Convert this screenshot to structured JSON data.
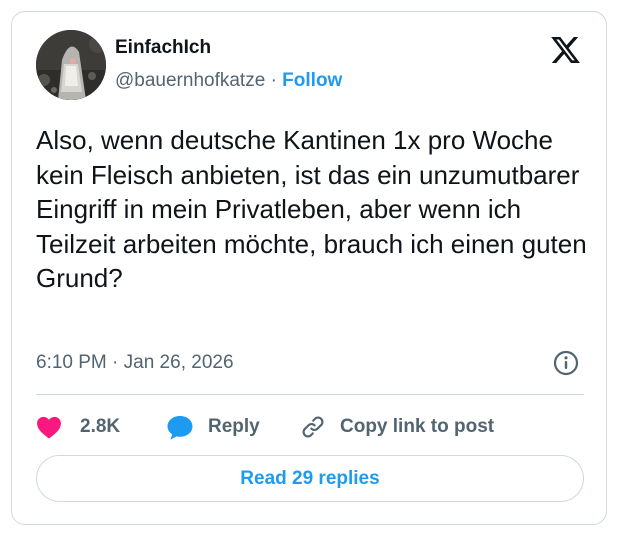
{
  "author": {
    "display_name": "EinfachIch",
    "handle": "@bauernhofkatze",
    "separator": "·",
    "follow_label": "Follow"
  },
  "tweet": {
    "text": "Also, wenn deutsche Kantinen 1x pro Woche kein Fleisch anbieten, ist das ein unzumutbarer Eingriff in mein Privatleben, aber wenn ich Teilzeit arbeiten möchte, brauch ich einen guten Grund?",
    "timestamp": "6:10 PM · Jan 26, 2026"
  },
  "actions": {
    "likes_count": "2.8K",
    "reply_label": "Reply",
    "copy_link_label": "Copy link to post"
  },
  "footer": {
    "read_replies_label": "Read 29 replies"
  },
  "icons": {
    "like": "heart-icon",
    "reply": "speech-bubble-icon",
    "copy": "link-icon",
    "info": "info-icon",
    "brand": "x-logo-icon"
  },
  "colors": {
    "accent": "#1d9bf0",
    "like": "#f91880",
    "text": "#0f1419",
    "secondary": "#536471",
    "border": "#cfd9de"
  }
}
